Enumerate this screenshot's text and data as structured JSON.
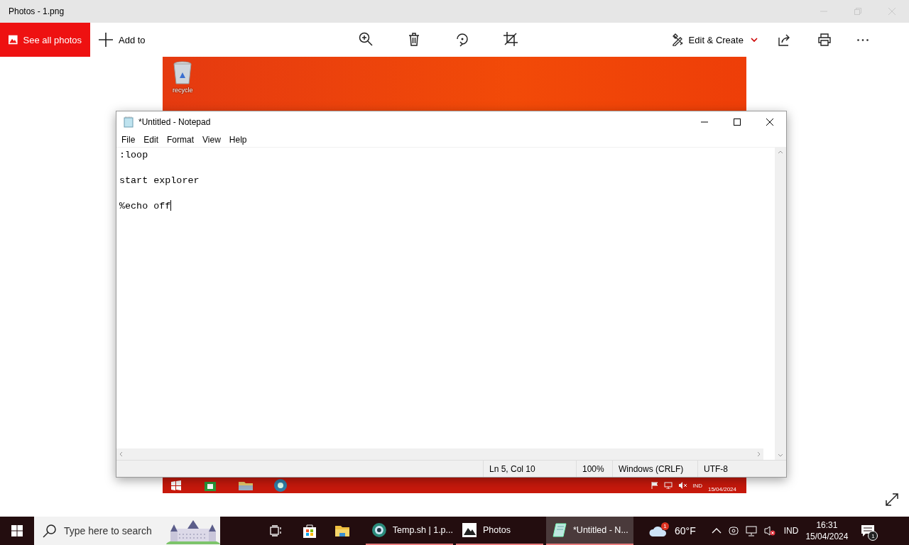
{
  "photos_window": {
    "title": "Photos - 1.png",
    "toolbar": {
      "see_all": "See all photos",
      "add_to": "Add to",
      "edit_create": "Edit & Create"
    }
  },
  "photo_content": {
    "desktop_icon_label": "recycle",
    "tray": {
      "language": "IND",
      "date": "15/04/2024"
    }
  },
  "notepad": {
    "title": "*Untitled - Notepad",
    "menu": [
      "File",
      "Edit",
      "Format",
      "View",
      "Help"
    ],
    "text": ":loop\n\nstart explorer\n\n%echo off",
    "status": {
      "position": "Ln 5, Col 10",
      "zoom": "100%",
      "line_ending": "Windows (CRLF)",
      "encoding": "UTF-8"
    }
  },
  "taskbar": {
    "search_placeholder": "Type here to search",
    "apps": [
      {
        "label": "Temp.sh | 1.p...",
        "kind": "browser",
        "selected": false
      },
      {
        "label": "Photos",
        "kind": "photos",
        "selected": false
      },
      {
        "label": "*Untitled - N...",
        "kind": "notepad",
        "selected": true
      }
    ],
    "weather": {
      "badge": "1",
      "temperature": "60°F"
    },
    "language": "IND",
    "time": "16:31",
    "date": "15/04/2024",
    "notification_count": "1"
  }
}
